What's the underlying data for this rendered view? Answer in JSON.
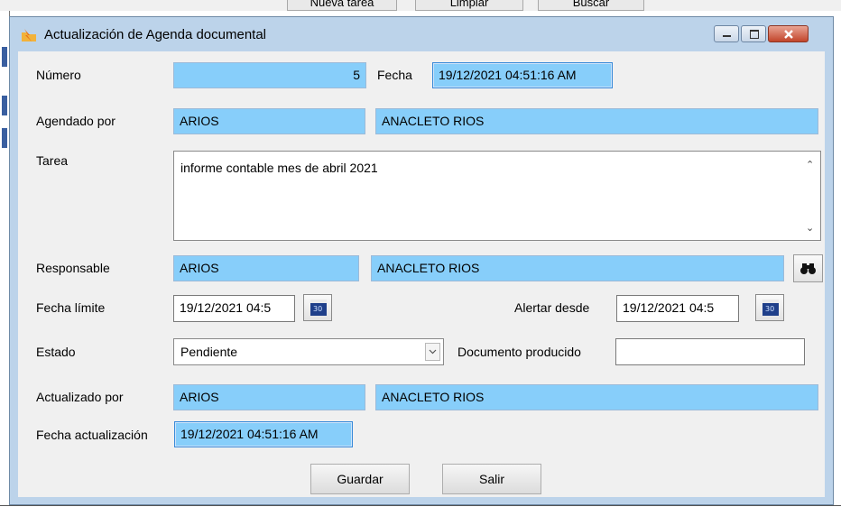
{
  "background_app": {
    "buttons": [
      "Nueva tarea",
      "Limpiar",
      "Buscar"
    ]
  },
  "window": {
    "title": "Actualización de Agenda documental",
    "icon": "lightning-folder-icon",
    "controls": [
      "minimize-icon",
      "maximize-icon",
      "close-icon"
    ]
  },
  "form": {
    "numero": {
      "label": "Número",
      "value": "5"
    },
    "fecha": {
      "label": "Fecha",
      "value": "19/12/2021 04:51:16 AM"
    },
    "agendado_por": {
      "label": "Agendado por",
      "code": "ARIOS",
      "name": "ANACLETO RIOS"
    },
    "tarea": {
      "label": "Tarea",
      "value": "informe contable mes de abril 2021"
    },
    "responsable": {
      "label": "Responsable",
      "code": "ARIOS",
      "name": "ANACLETO RIOS",
      "search_icon": "binoculars-icon"
    },
    "fecha_limite": {
      "label": "Fecha límite",
      "value": "19/12/2021 04:5",
      "calendar_icon_text": "30"
    },
    "alertar_desde": {
      "label": "Alertar desde",
      "value": "19/12/2021 04:5",
      "calendar_icon_text": "30"
    },
    "estado": {
      "label": "Estado",
      "value": "Pendiente"
    },
    "documento_producido": {
      "label": "Documento producido",
      "value": ""
    },
    "actualizado_por": {
      "label": "Actualizado por",
      "code": "ARIOS",
      "name": "ANACLETO RIOS"
    },
    "fecha_actualizacion": {
      "label": "Fecha actualización",
      "value": "19/12/2021 04:51:16 AM"
    }
  },
  "buttons": {
    "guardar": "Guardar",
    "salir": "Salir"
  },
  "colors": {
    "readonly_field": "#87cefa",
    "window_frame": "#bcd3ea",
    "close_button": "#c2452b",
    "calendar_icon": "#1f3f8a"
  }
}
